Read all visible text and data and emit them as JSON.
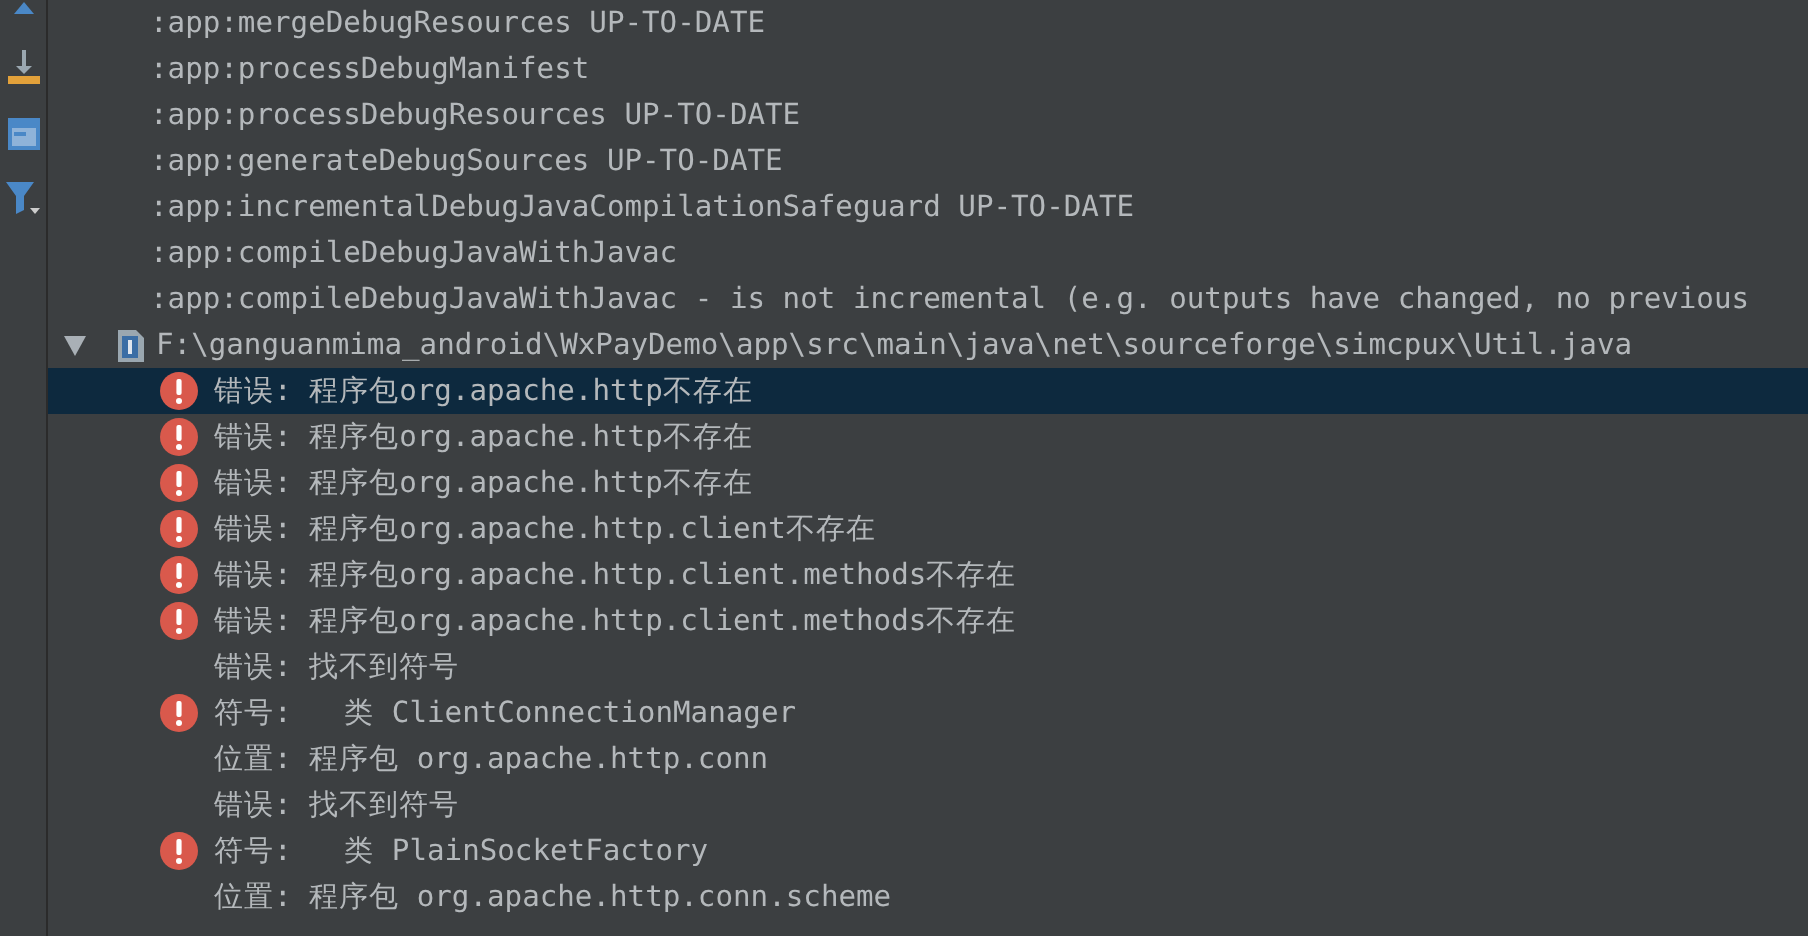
{
  "log_lines": [
    ":app:mergeDebugResources UP-TO-DATE",
    ":app:processDebugManifest",
    ":app:processDebugResources UP-TO-DATE",
    ":app:generateDebugSources UP-TO-DATE",
    ":app:incrementalDebugJavaCompilationSafeguard UP-TO-DATE",
    ":app:compileDebugJavaWithJavac",
    ":app:compileDebugJavaWithJavac - is not incremental (e.g. outputs have changed, no previous"
  ],
  "file_node": {
    "path": "F:\\ganguanmima_android\\WxPayDemo\\app\\src\\main\\java\\net\\sourceforge\\simcpux\\Util.java",
    "expanded": true,
    "children": [
      {
        "kind": "error",
        "text": "错误: 程序包org.apache.http不存在",
        "selected": true
      },
      {
        "kind": "error",
        "text": "错误: 程序包org.apache.http不存在",
        "selected": false
      },
      {
        "kind": "error",
        "text": "错误: 程序包org.apache.http不存在",
        "selected": false
      },
      {
        "kind": "error",
        "text": "错误: 程序包org.apache.http.client不存在",
        "selected": false
      },
      {
        "kind": "error",
        "text": "错误: 程序包org.apache.http.client.methods不存在",
        "selected": false
      },
      {
        "kind": "error",
        "text": "错误: 程序包org.apache.http.client.methods不存在",
        "selected": false
      },
      {
        "kind": "detail",
        "text": "错误: 找不到符号",
        "selected": false
      },
      {
        "kind": "error",
        "text": "符号:   类 ClientConnectionManager",
        "selected": false
      },
      {
        "kind": "detail",
        "text": "位置: 程序包 org.apache.http.conn",
        "selected": false
      },
      {
        "kind": "detail",
        "text": "错误: 找不到符号",
        "selected": false
      },
      {
        "kind": "error",
        "text": "符号:   类 PlainSocketFactory",
        "selected": false
      },
      {
        "kind": "detail",
        "text": "位置: 程序包 org.apache.http.conn.scheme",
        "selected": false
      }
    ]
  }
}
